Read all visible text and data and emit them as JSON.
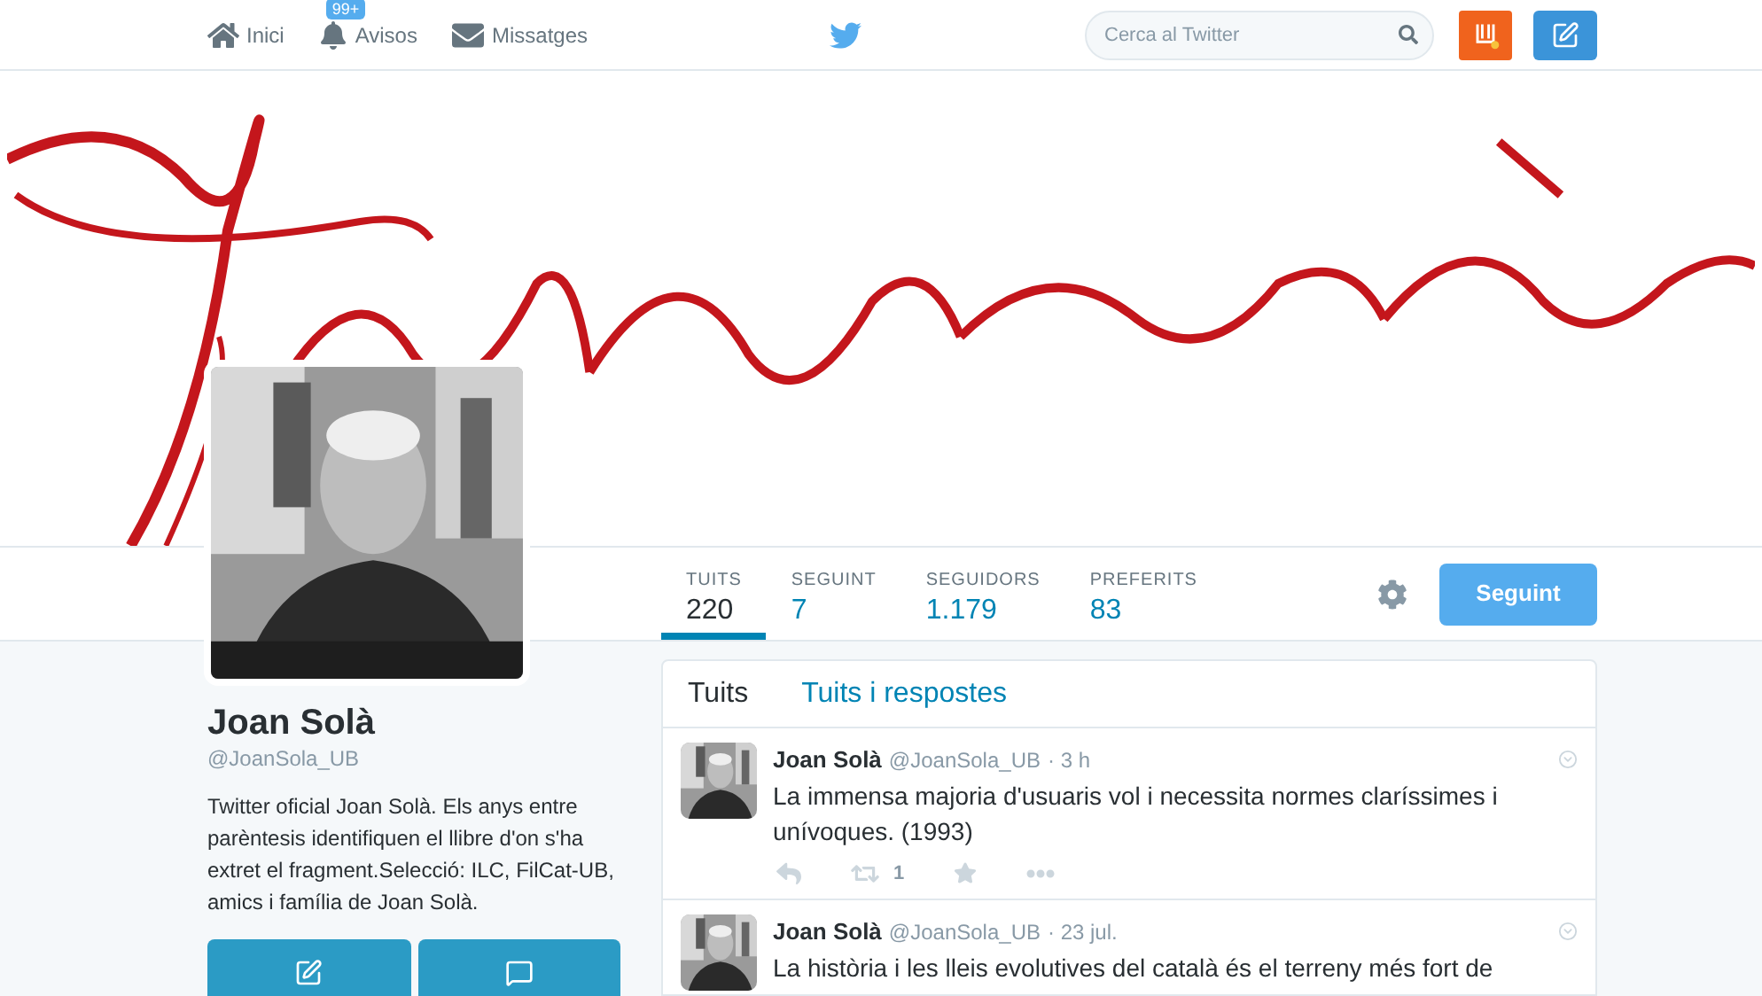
{
  "nav": {
    "items": [
      {
        "kind": "home",
        "label": "Inici"
      },
      {
        "kind": "notifications",
        "label": "Avisos",
        "badge": "99+"
      },
      {
        "kind": "messages",
        "label": "Missatges"
      }
    ],
    "search": {
      "placeholder": "Cerca al Twitter"
    }
  },
  "profile": {
    "name": "Joan Solà",
    "handle": "@JoanSola_UB",
    "bio": "Twitter oficial Joan Solà. Els anys entre parèntesis identifiquen el llibre d'on s'ha extret el fragment.Selecció: ILC, FilCat-UB, amics i família de Joan Solà."
  },
  "stats": [
    {
      "label": "TUITS",
      "value": "220",
      "selected": true
    },
    {
      "label": "SEGUINT",
      "value": "7",
      "selected": false
    },
    {
      "label": "SEGUIDORS",
      "value": "1.179",
      "selected": false
    },
    {
      "label": "PREFERITS",
      "value": "83",
      "selected": false
    }
  ],
  "follow_button": "Seguint",
  "tabs": [
    {
      "label": "Tuits",
      "selected": true
    },
    {
      "label": "Tuits i respostes",
      "selected": false
    }
  ],
  "tweets": [
    {
      "name": "Joan Solà",
      "handle": "@JoanSola_UB",
      "time": "· 3 h",
      "text": "La immensa majoria d'usuaris vol i necessita normes claríssimes i unívoques. (1993)",
      "retweets": "1"
    },
    {
      "name": "Joan Solà",
      "handle": "@JoanSola_UB",
      "time": "· 23 jul.",
      "text": "La història i les lleis evolutives del català és el terreny més fort de"
    }
  ]
}
